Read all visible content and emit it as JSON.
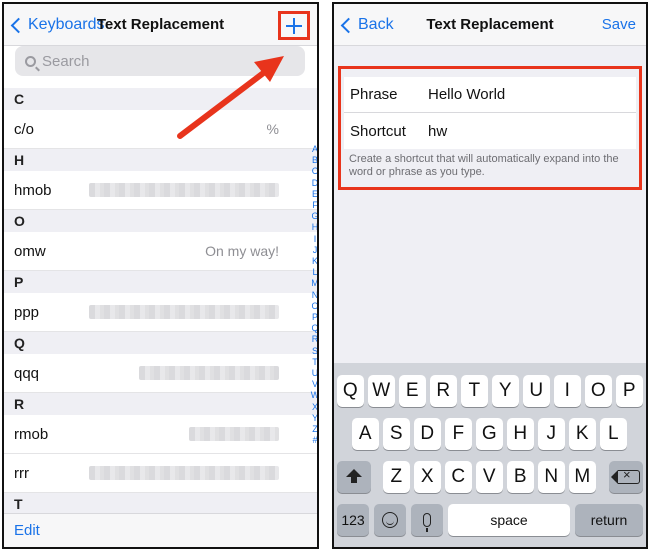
{
  "left": {
    "nav": {
      "back_label": "Keyboards",
      "title": "Text Replacement",
      "add_label": "+"
    },
    "search": {
      "placeholder": "Search"
    },
    "sections": [
      {
        "letter": "C",
        "rows": [
          {
            "shortcut": "c/o",
            "phrase": "%"
          }
        ]
      },
      {
        "letter": "H",
        "rows": [
          {
            "shortcut": "hmob",
            "phrase": ""
          }
        ]
      },
      {
        "letter": "O",
        "rows": [
          {
            "shortcut": "omw",
            "phrase": "On my way!"
          }
        ]
      },
      {
        "letter": "P",
        "rows": [
          {
            "shortcut": "ppp",
            "phrase": ""
          }
        ]
      },
      {
        "letter": "Q",
        "rows": [
          {
            "shortcut": "qqq",
            "phrase": ""
          }
        ]
      },
      {
        "letter": "R",
        "rows": [
          {
            "shortcut": "rmob",
            "phrase": ""
          },
          {
            "shortcut": "rrr",
            "phrase": ""
          }
        ]
      },
      {
        "letter": "T",
        "rows": []
      }
    ],
    "index": [
      "A",
      "B",
      "C",
      "D",
      "E",
      "F",
      "G",
      "H",
      "I",
      "J",
      "K",
      "L",
      "M",
      "N",
      "O",
      "P",
      "Q",
      "R",
      "S",
      "T",
      "U",
      "V",
      "W",
      "X",
      "Y",
      "Z",
      "#"
    ],
    "toolbar": {
      "edit_label": "Edit"
    }
  },
  "right": {
    "nav": {
      "back_label": "Back",
      "title": "Text Replacement",
      "save_label": "Save"
    },
    "form": {
      "phrase_label": "Phrase",
      "phrase_value": "Hello World",
      "shortcut_label": "Shortcut",
      "shortcut_value": "hw",
      "hint": "Create a shortcut that will automatically expand into the word or phrase as you type."
    },
    "keyboard": {
      "row1": [
        "Q",
        "W",
        "E",
        "R",
        "T",
        "Y",
        "U",
        "I",
        "O",
        "P"
      ],
      "row2": [
        "A",
        "S",
        "D",
        "F",
        "G",
        "H",
        "J",
        "K",
        "L"
      ],
      "row3": [
        "Z",
        "X",
        "C",
        "V",
        "B",
        "N",
        "M"
      ],
      "numbers_label": "123",
      "space_label": "space",
      "return_label": "return"
    }
  },
  "colors": {
    "accent": "#1a73e8",
    "highlight": "#e8341c"
  }
}
